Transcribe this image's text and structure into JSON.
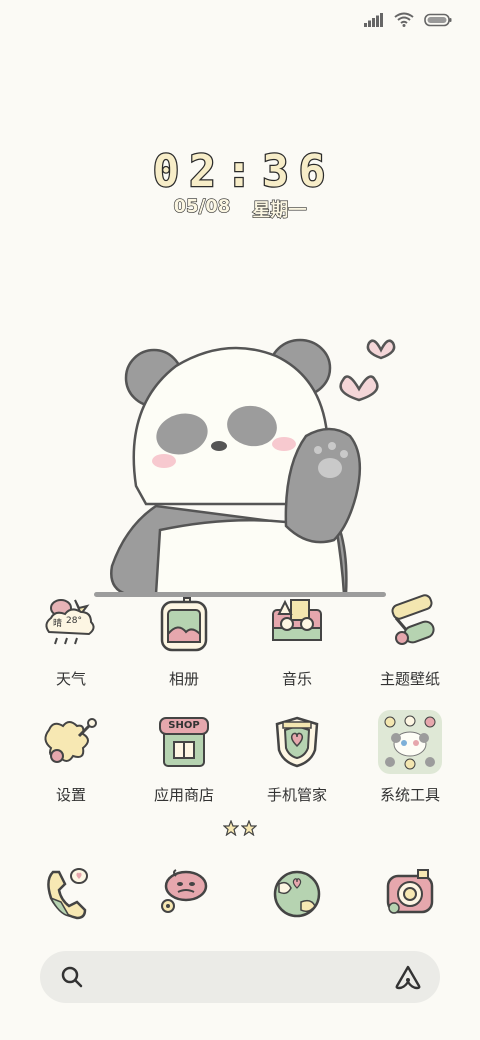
{
  "clock": {
    "time": "02:36",
    "date": "05/08",
    "weekday": "星期一"
  },
  "weather": {
    "condition": "晴",
    "temp": "28°"
  },
  "apps_row1": [
    {
      "label": "天气",
      "icon": "weather-icon"
    },
    {
      "label": "相册",
      "icon": "gallery-icon"
    },
    {
      "label": "音乐",
      "icon": "music-icon"
    },
    {
      "label": "主题壁纸",
      "icon": "theme-wallpaper-icon"
    }
  ],
  "apps_row2": [
    {
      "label": "设置",
      "icon": "settings-icon"
    },
    {
      "label": "应用商店",
      "icon": "app-store-icon"
    },
    {
      "label": "手机管家",
      "icon": "phone-manager-icon"
    },
    {
      "label": "系统工具",
      "icon": "system-tools-folder-icon"
    }
  ],
  "shop_sign": "SHOP",
  "dock": [
    {
      "icon": "phone-icon"
    },
    {
      "icon": "messages-icon"
    },
    {
      "icon": "browser-icon"
    },
    {
      "icon": "camera-icon"
    }
  ],
  "search": {
    "placeholder": "",
    "left_icon": "search-icon",
    "right_icon": "assistant-icon"
  },
  "colors": {
    "background": "#fbfaf5",
    "panda_gray": "#9c9c9c",
    "heart_pink": "#f4d6d8",
    "search_bg": "#ebebe7"
  }
}
